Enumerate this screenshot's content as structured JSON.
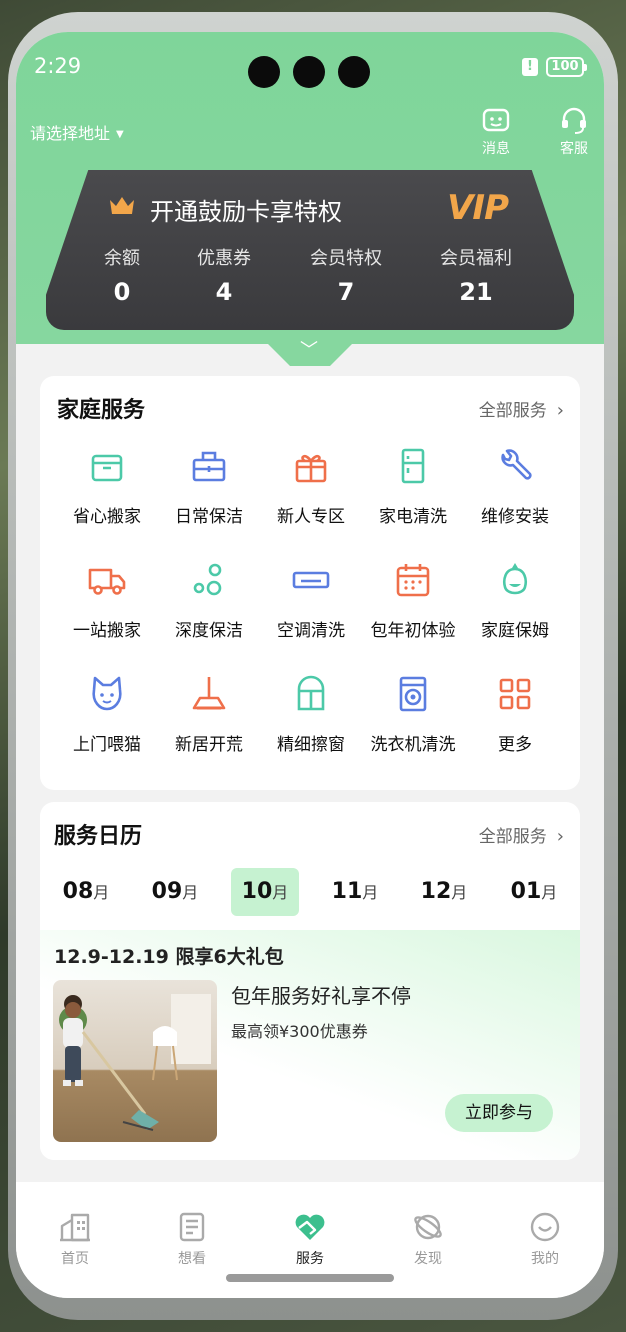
{
  "status": {
    "time": "2:29",
    "battery": "100"
  },
  "header": {
    "address": "请选择地址",
    "message_label": "消息",
    "service_label": "客服"
  },
  "vip": {
    "title": "开通鼓励卡享特权",
    "logo": "VIP",
    "stats": [
      {
        "label": "余额",
        "value": "0"
      },
      {
        "label": "优惠券",
        "value": "4"
      },
      {
        "label": "会员特权",
        "value": "7"
      },
      {
        "label": "会员福利",
        "value": "21"
      }
    ]
  },
  "home_services": {
    "title": "家庭服务",
    "more": "全部服务",
    "items": [
      {
        "label": "省心搬家",
        "icon": "box-icon"
      },
      {
        "label": "日常保洁",
        "icon": "cleaning-kit-icon"
      },
      {
        "label": "新人专区",
        "icon": "gift-icon"
      },
      {
        "label": "家电清洗",
        "icon": "fridge-icon"
      },
      {
        "label": "维修安装",
        "icon": "wrench-icon"
      },
      {
        "label": "一站搬家",
        "icon": "truck-icon"
      },
      {
        "label": "深度保洁",
        "icon": "bubbles-icon"
      },
      {
        "label": "空调清洗",
        "icon": "air-conditioner-icon"
      },
      {
        "label": "包年初体验",
        "icon": "calendar-icon"
      },
      {
        "label": "家庭保姆",
        "icon": "nanny-icon"
      },
      {
        "label": "上门喂猫",
        "icon": "cat-icon"
      },
      {
        "label": "新居开荒",
        "icon": "broom-icon"
      },
      {
        "label": "精细擦窗",
        "icon": "window-icon"
      },
      {
        "label": "洗衣机清洗",
        "icon": "washing-machine-icon"
      },
      {
        "label": "更多",
        "icon": "grid-icon"
      }
    ]
  },
  "calendar": {
    "title": "服务日历",
    "more": "全部服务",
    "months": [
      {
        "num": "08",
        "unit": "月"
      },
      {
        "num": "09",
        "unit": "月"
      },
      {
        "num": "10",
        "unit": "月"
      },
      {
        "num": "11",
        "unit": "月"
      },
      {
        "num": "12",
        "unit": "月"
      },
      {
        "num": "01",
        "unit": "月"
      }
    ],
    "active_month": "10",
    "promo": {
      "title": "12.9-12.19 限享6大礼包",
      "headline": "包年服务好礼享不停",
      "subtitle": "最高领¥300优惠券",
      "button": "立即参与"
    }
  },
  "tabs": [
    {
      "label": "首页",
      "icon": "building-icon"
    },
    {
      "label": "想看",
      "icon": "document-icon"
    },
    {
      "label": "服务",
      "icon": "heart-hands-icon"
    },
    {
      "label": "发现",
      "icon": "planet-icon"
    },
    {
      "label": "我的",
      "icon": "smile-icon"
    }
  ],
  "colors": {
    "green": "#7fd59a",
    "accent_light": "#c6f2d1",
    "vip_gold": "#f2a64a",
    "vip_card": "#3f3f42"
  }
}
